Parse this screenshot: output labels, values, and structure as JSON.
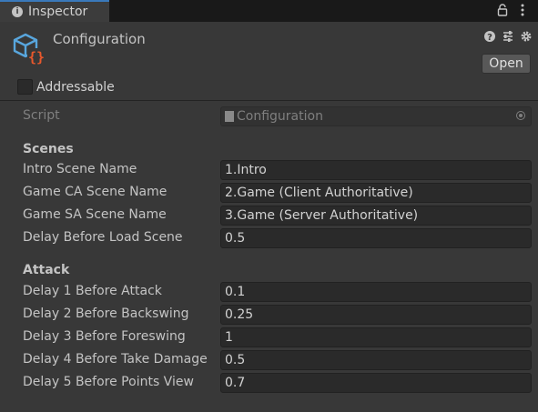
{
  "tab": {
    "title": "Inspector"
  },
  "header": {
    "title": "Configuration",
    "open_label": "Open"
  },
  "addressable": {
    "label": "Addressable",
    "checked": false
  },
  "script": {
    "label": "Script",
    "value": "Configuration"
  },
  "scenes": {
    "heading": "Scenes",
    "rows": [
      {
        "label": "Intro Scene Name",
        "value": "1.Intro"
      },
      {
        "label": "Game CA Scene Name",
        "value": "2.Game (Client Authoritative)"
      },
      {
        "label": "Game SA Scene Name",
        "value": "3.Game (Server Authoritative)"
      },
      {
        "label": "Delay Before Load Scene",
        "value": "0.5"
      }
    ]
  },
  "attack": {
    "heading": "Attack",
    "rows": [
      {
        "label": "Delay 1 Before Attack",
        "value": "0.1"
      },
      {
        "label": "Delay 2 Before Backswing",
        "value": "0.25"
      },
      {
        "label": "Delay 3 Before Foreswing",
        "value": "1"
      },
      {
        "label": "Delay 4 Before Take Damage",
        "value": "0.5"
      },
      {
        "label": "Delay 5 Before Points View",
        "value": "0.7"
      }
    ]
  },
  "icons": {
    "tab": "info-icon",
    "lock": "lock-icon",
    "menu": "kebab-menu-icon",
    "asset": "scriptable-object-icon",
    "help": "help-icon",
    "presets": "presets-icon",
    "settings": "gear-icon"
  }
}
